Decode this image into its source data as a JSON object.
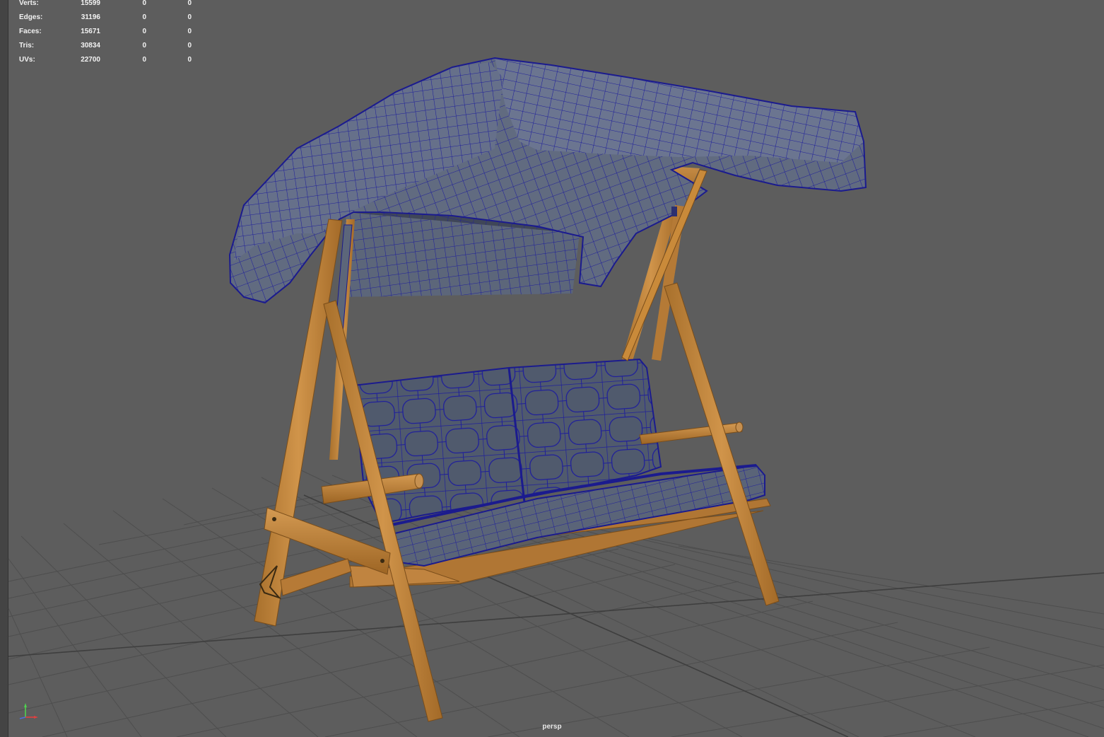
{
  "hud": {
    "rows": [
      {
        "label": "Verts:",
        "v1": "15599",
        "v2": "0",
        "v3": "0"
      },
      {
        "label": "Edges:",
        "v1": "31196",
        "v2": "0",
        "v3": "0"
      },
      {
        "label": "Faces:",
        "v1": "15671",
        "v2": "0",
        "v3": "0"
      },
      {
        "label": "Tris:",
        "v1": "30834",
        "v2": "0",
        "v3": "0"
      },
      {
        "label": "UVs:",
        "v1": "22700",
        "v2": "0",
        "v3": "0"
      }
    ]
  },
  "camera": {
    "label": "persp"
  },
  "colors": {
    "viewport_bg": "#5d5d5d",
    "grid": "#4b4b4b",
    "wood": "#c98a3a",
    "wood_dark": "#8a5a20",
    "fabric": "#5a6478",
    "wire": "#1a1a8c"
  },
  "gizmo": {
    "icons": [
      "axis-x-icon",
      "axis-y-icon",
      "axis-z-icon"
    ]
  }
}
